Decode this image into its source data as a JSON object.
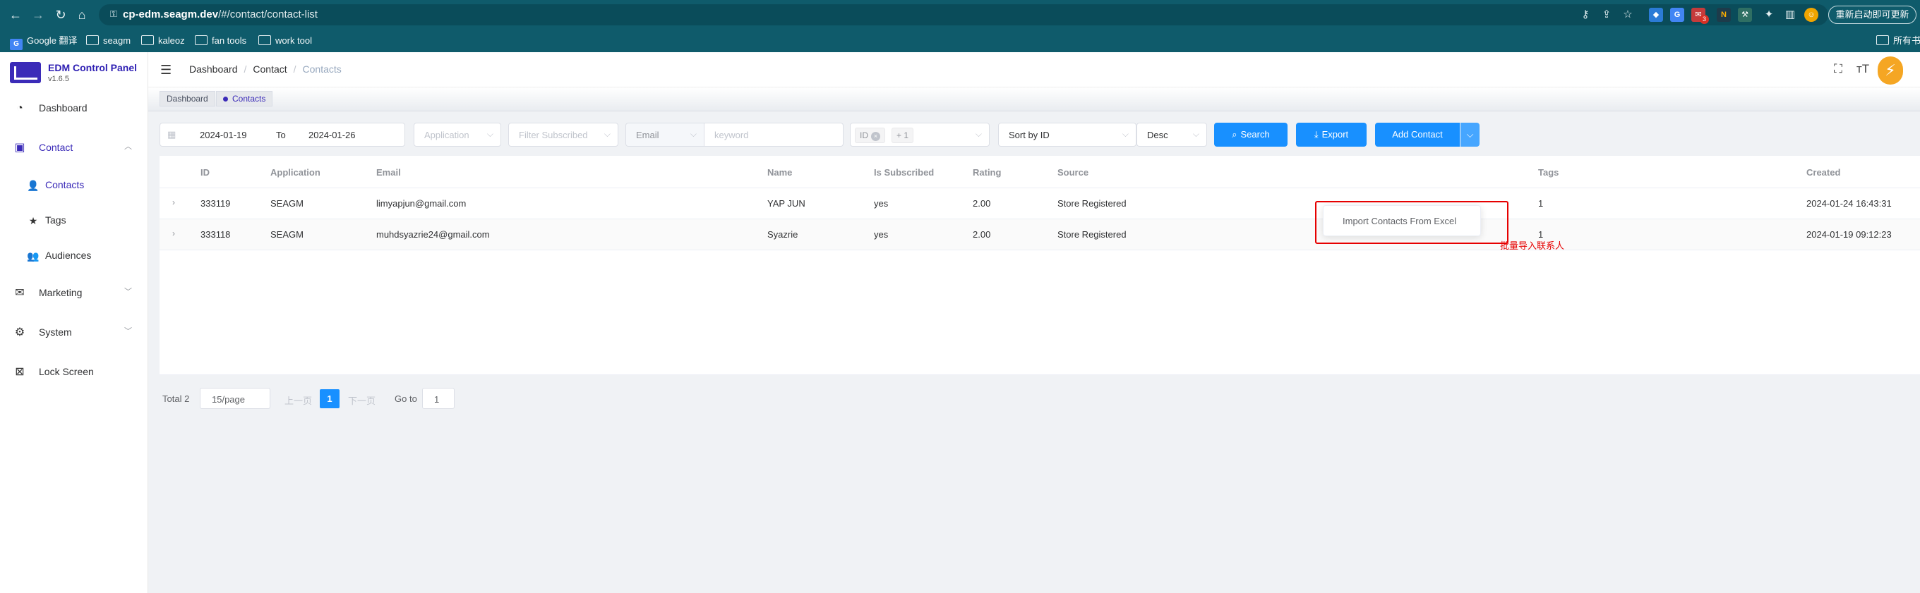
{
  "browser": {
    "url_host": "cp-edm.seagm.dev",
    "url_path": "/#/contact/contact-list",
    "restart_label": "重新启动即可更新",
    "ext_badge": "3",
    "bookmarks": [
      {
        "label": "Google 翻译"
      },
      {
        "label": "seagm"
      },
      {
        "label": "kaleoz"
      },
      {
        "label": "fan tools"
      },
      {
        "label": "work tool"
      }
    ],
    "all_bookmarks": "所有书"
  },
  "logo": {
    "title": "EDM Control Panel",
    "version": "v1.6.5"
  },
  "sidebar": {
    "items": [
      {
        "label": "Dashboard",
        "icon": "dashboard-icon"
      },
      {
        "label": "Contact",
        "icon": "contact-card-icon"
      },
      {
        "label": "Marketing",
        "icon": "mail-icon"
      },
      {
        "label": "System",
        "icon": "gear-icon"
      },
      {
        "label": "Lock Screen",
        "icon": "lock-screen-icon"
      }
    ],
    "sub_items": [
      {
        "label": "Contacts",
        "icon": "user-add-icon"
      },
      {
        "label": "Tags",
        "icon": "star-icon"
      },
      {
        "label": "Audiences",
        "icon": "group-icon"
      }
    ]
  },
  "breadcrumb": [
    "Dashboard",
    "Contact",
    "Contacts"
  ],
  "tags_view": {
    "tabs": [
      "Dashboard",
      "Contacts"
    ]
  },
  "filters": {
    "date_start": "2024-01-19",
    "date_sep": "To",
    "date_end": "2024-01-26",
    "application_placeholder": "Application",
    "subscribed_placeholder": "Filter Subscribed",
    "field_select": "Email",
    "keyword_placeholder": "keyword",
    "columns_chip": "ID",
    "columns_more": "+ 1",
    "sort_by": "Sort by ID",
    "order": "Desc",
    "search_label": "Search",
    "export_label": "Export",
    "add_contact_label": "Add Contact"
  },
  "dropdown": {
    "import_label": "Import Contacts From Excel"
  },
  "annotation": "批量导入联系人",
  "table": {
    "columns": [
      "ID",
      "Application",
      "Email",
      "Name",
      "Is Subscribed",
      "Rating",
      "Source",
      "Tags",
      "Created"
    ],
    "rows": [
      {
        "id": "333119",
        "application": "SEAGM",
        "email": "limyapjun@gmail.com",
        "name": "YAP JUN",
        "subscribed": "yes",
        "rating": "2.00",
        "source": "Store Registered",
        "tags": "1",
        "created": "2024-01-24 16:43:31"
      },
      {
        "id": "333118",
        "application": "SEAGM",
        "email": "muhdsyazrie24@gmail.com",
        "name": "Syazrie",
        "subscribed": "yes",
        "rating": "2.00",
        "source": "Store Registered",
        "tags": "1",
        "created": "2024-01-19 09:12:23"
      }
    ]
  },
  "pagination": {
    "total": "Total 2",
    "page_size": "15/page",
    "prev": "上一页",
    "current": "1",
    "next": "下一页",
    "goto_label": "Go to",
    "goto_value": "1"
  },
  "colors": {
    "primary": "#1890ff",
    "brand": "#3b2bb8",
    "browser": "#0f5b6b",
    "highlight": "#e60000"
  }
}
